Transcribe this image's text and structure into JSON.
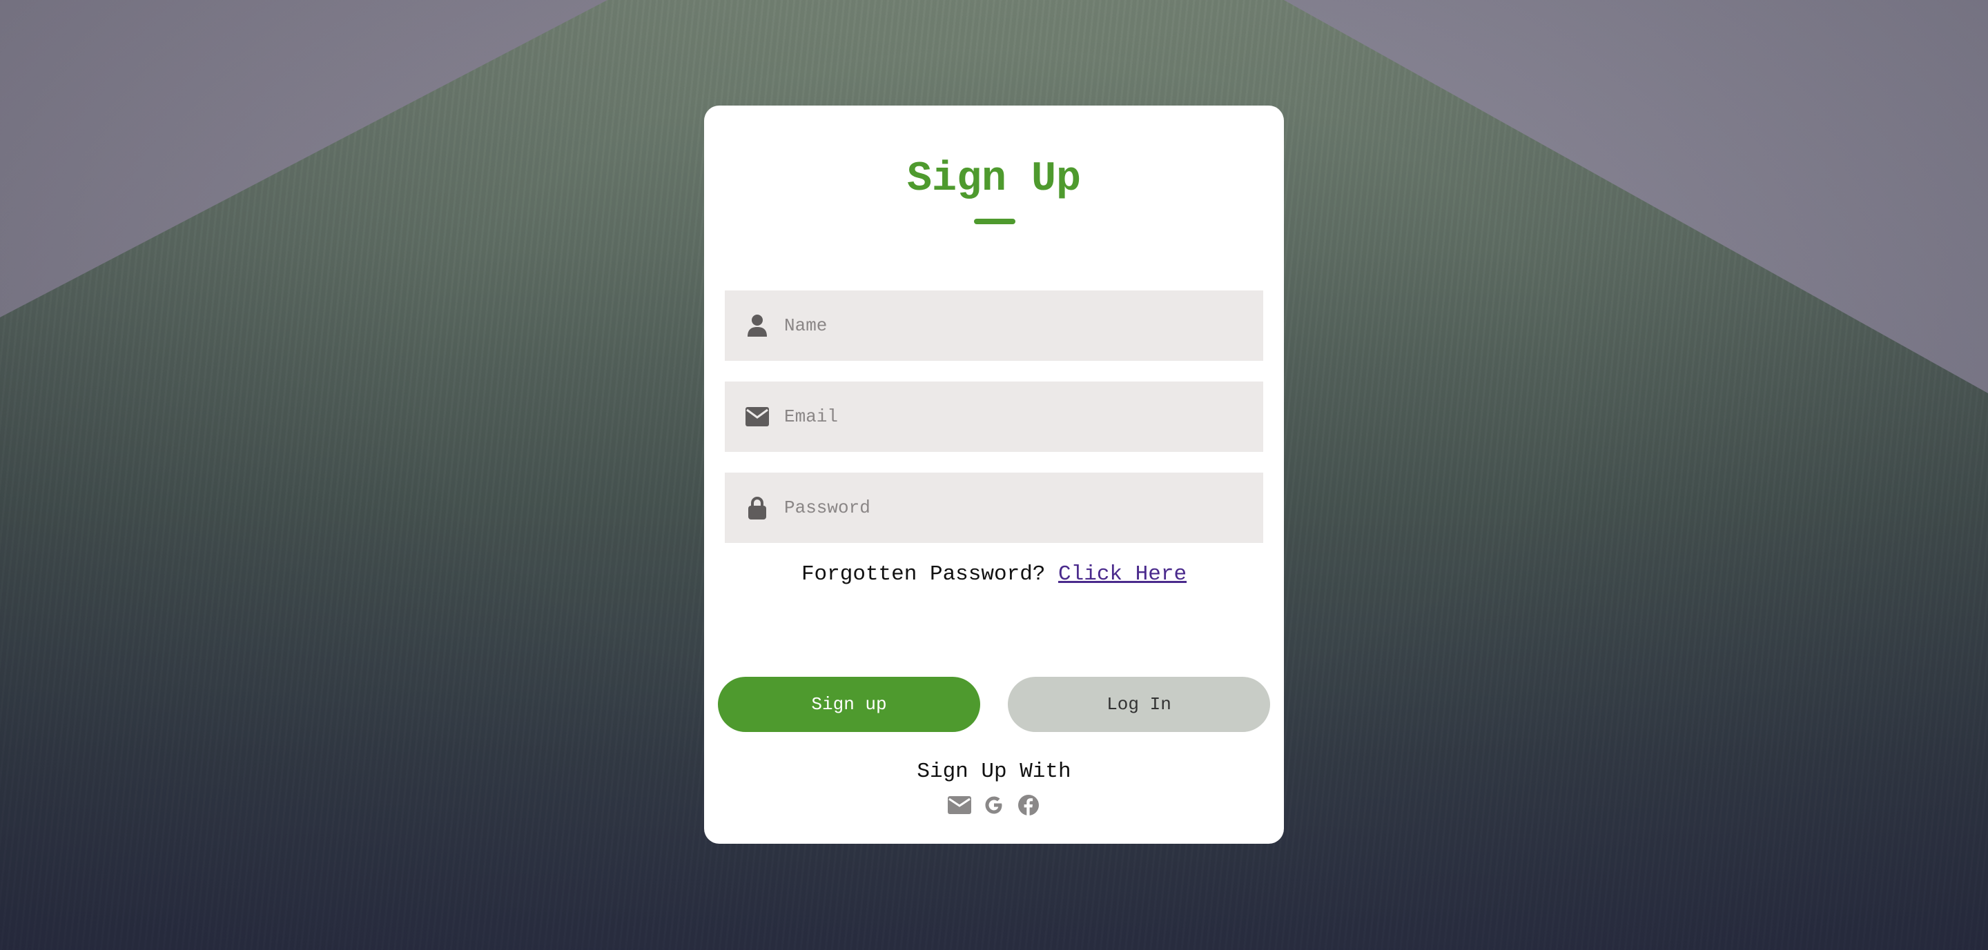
{
  "form": {
    "title": "Sign Up",
    "fields": {
      "name": {
        "placeholder": "Name",
        "value": "",
        "icon": "user-icon"
      },
      "email": {
        "placeholder": "Email",
        "value": "",
        "icon": "envelope-icon"
      },
      "password": {
        "placeholder": "Password",
        "value": "",
        "icon": "lock-icon"
      }
    },
    "forgot_text": "Forgotten Password?",
    "forgot_link": "Click Here",
    "signup_button": "Sign up",
    "login_button": "Log In",
    "signup_with": "Sign Up With",
    "social_icons": [
      "envelope-icon",
      "google-icon",
      "facebook-icon"
    ]
  },
  "colors": {
    "accent": "#4e9a2e",
    "secondary_button": "#c8ccc6",
    "input_bg": "#ece9e8",
    "link": "#4a2a8c",
    "icon": "#5f5c5c",
    "social_icon": "#8a8888"
  }
}
